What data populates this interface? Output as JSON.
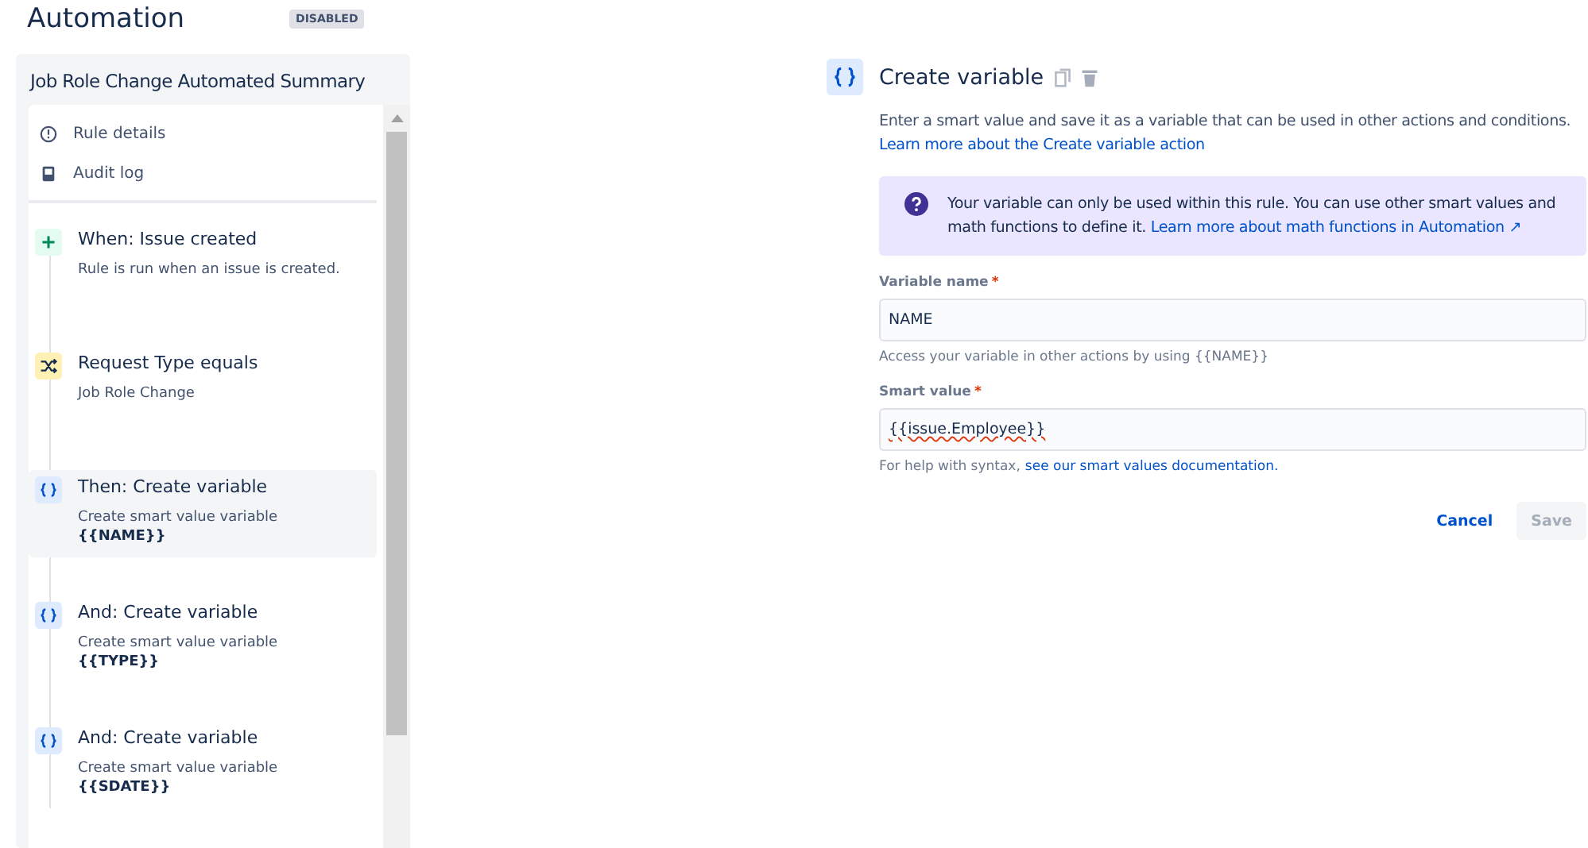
{
  "page": {
    "title": "Automation",
    "status": "DISABLED"
  },
  "rule": {
    "name": "Job Role Change Automated Summary",
    "menu": [
      {
        "kind": "info",
        "label": "Rule details"
      },
      {
        "kind": "log",
        "label": "Audit log"
      }
    ],
    "steps": [
      {
        "kind": "trigger",
        "title": "When: Issue created",
        "detail": "Rule is run when an issue is created.",
        "selected": false
      },
      {
        "kind": "condition",
        "title": "Request Type equals",
        "detail": "Job Role Change",
        "selected": false
      },
      {
        "kind": "action",
        "title": "Then: Create variable",
        "detail": "Create smart value variable",
        "variable": "{{NAME}}",
        "selected": true
      },
      {
        "kind": "action",
        "title": "And: Create variable",
        "detail": "Create smart value variable",
        "variable": "{{TYPE}}",
        "selected": false
      },
      {
        "kind": "action",
        "title": "And: Create variable",
        "detail": "Create smart value variable",
        "variable": "{{SDATE}}",
        "selected": false
      }
    ]
  },
  "editor": {
    "title": "Create variable",
    "description": "Enter a smart value and save it as a variable that can be used in other actions and conditions.",
    "description_link": "Learn more about the Create variable action",
    "info": {
      "text": "Your variable can only be used within this rule. You can use other smart values and math functions to define it.",
      "link": "Learn more about math functions in Automation ↗"
    },
    "fields": [
      {
        "label": "Variable name",
        "required_mark": "*",
        "value": "NAME",
        "help": "Access your variable in other actions by using {{NAME}}",
        "spellcheck_error": false
      },
      {
        "label": "Smart value",
        "required_mark": "*",
        "value": "{{issue.Employee}}",
        "help": "For help with syntax,",
        "help_link": "see our smart values documentation.",
        "spellcheck_error": true
      }
    ],
    "buttons": [
      {
        "kind": "cancel",
        "label": "Cancel",
        "disabled": false
      },
      {
        "kind": "save",
        "label": "Save",
        "disabled": true
      }
    ]
  }
}
